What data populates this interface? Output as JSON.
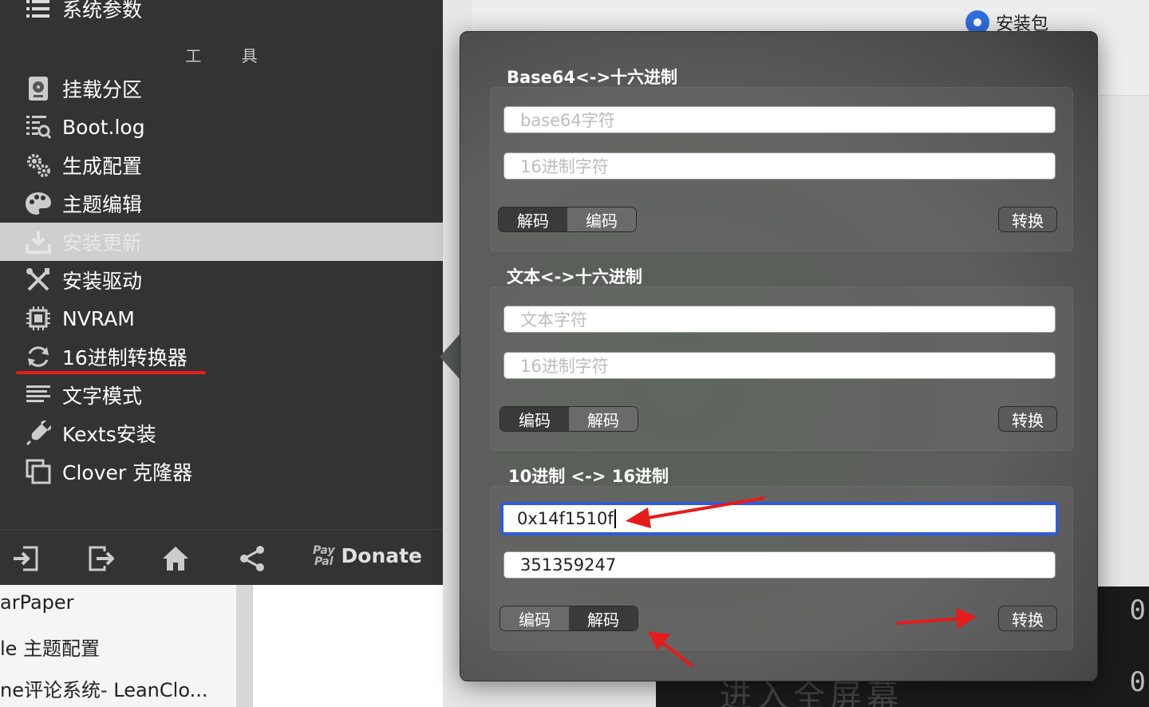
{
  "sidebar": {
    "top_item": "系统参数",
    "section_title": "工 具",
    "items": [
      {
        "label": "挂载分区",
        "icon": "disk-icon"
      },
      {
        "label": "Boot.log",
        "icon": "log-list-icon"
      },
      {
        "label": "生成配置",
        "icon": "gears-icon"
      },
      {
        "label": "主题编辑",
        "icon": "palette-icon"
      },
      {
        "label": "安装更新",
        "icon": "download-icon"
      },
      {
        "label": "安装驱动",
        "icon": "tools-icon"
      },
      {
        "label": "NVRAM",
        "icon": "chip-icon"
      },
      {
        "label": "16进制转换器",
        "icon": "refresh-icon"
      },
      {
        "label": "文字模式",
        "icon": "text-lines-icon"
      },
      {
        "label": "Kexts安装",
        "icon": "plug-icon"
      },
      {
        "label": "Clover 克隆器",
        "icon": "clone-icon"
      }
    ],
    "selected_index": 4,
    "bottom": {
      "paypal_line1": "Pay",
      "paypal_line2": "Pal",
      "donate": "Donate"
    }
  },
  "background": {
    "radio_label": "安装包",
    "list": [
      "arPaper",
      "le 主题配置",
      "ne评论系统- LeanClo..."
    ],
    "dark_digits": [
      "0",
      "0"
    ],
    "dark_caption": "进入全屏幕"
  },
  "popover": {
    "sections": [
      {
        "title": "Base64<->十六进制",
        "field1": {
          "value": "",
          "placeholder": "base64字符"
        },
        "field2": {
          "value": "",
          "placeholder": "16进制字符"
        },
        "segment": [
          "解码",
          "编码"
        ],
        "segment_selected": 0,
        "convert": "转换"
      },
      {
        "title": "文本<->十六进制",
        "field1": {
          "value": "",
          "placeholder": "文本字符"
        },
        "field2": {
          "value": "",
          "placeholder": "16进制字符"
        },
        "segment": [
          "编码",
          "解码"
        ],
        "segment_selected": 0,
        "convert": "转换"
      },
      {
        "title": "10进制 <-> 16进制",
        "field1": {
          "value": "0x14f1510f",
          "placeholder": ""
        },
        "field2": {
          "value": "351359247",
          "placeholder": ""
        },
        "segment": [
          "编码",
          "解码"
        ],
        "segment_selected": 1,
        "convert": "转换"
      }
    ]
  },
  "colors": {
    "sidebar_bg": "#333333",
    "annotation_red": "#e61b1b",
    "focus_blue": "#2e5bd7"
  }
}
